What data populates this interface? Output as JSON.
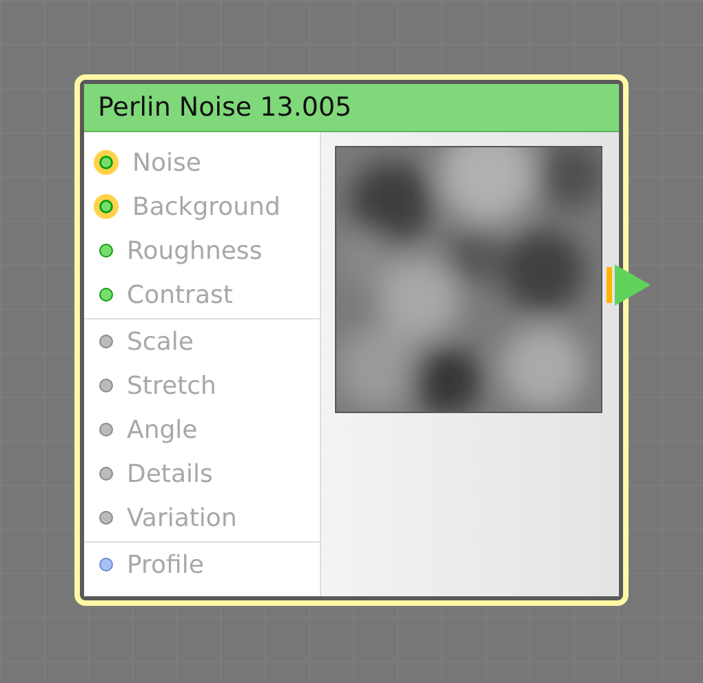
{
  "node": {
    "title": "Perlin Noise 13.005",
    "groups": [
      {
        "ports": [
          {
            "label": "Noise",
            "kind": "color",
            "connected": true
          },
          {
            "label": "Background",
            "kind": "color",
            "connected": true
          },
          {
            "label": "Roughness",
            "kind": "color",
            "connected": false
          },
          {
            "label": "Contrast",
            "kind": "color",
            "connected": false
          }
        ]
      },
      {
        "ports": [
          {
            "label": "Scale",
            "kind": "value",
            "connected": false
          },
          {
            "label": "Stretch",
            "kind": "value",
            "connected": false
          },
          {
            "label": "Angle",
            "kind": "value",
            "connected": false
          },
          {
            "label": "Details",
            "kind": "value",
            "connected": false
          },
          {
            "label": "Variation",
            "kind": "value",
            "connected": false
          }
        ]
      },
      {
        "ports": [
          {
            "label": "Profile",
            "kind": "curve",
            "connected": false
          }
        ]
      }
    ],
    "output": {
      "kind": "color",
      "connected": true
    }
  }
}
